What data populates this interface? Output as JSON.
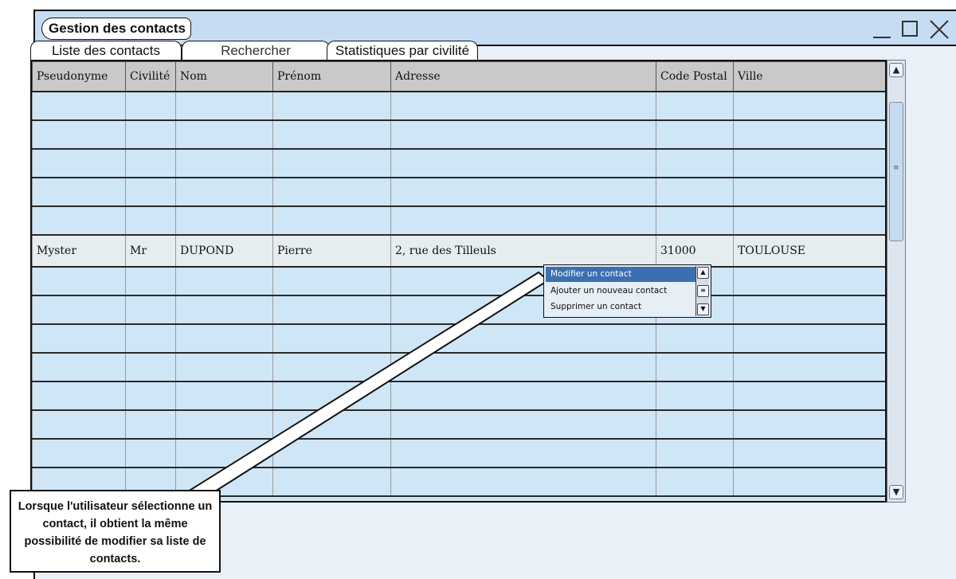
{
  "window": {
    "title": "Gestion des contacts",
    "controls": {
      "minimize": "minimize-icon",
      "maximize": "maximize-icon",
      "close": "close-icon"
    }
  },
  "tabs": [
    {
      "label": "Liste des contacts"
    },
    {
      "label": "Rechercher"
    },
    {
      "label": "Statistiques par civilité"
    }
  ],
  "table": {
    "columns": [
      "Pseudonyme",
      "Civilité",
      "Nom",
      "Prénom",
      "Adresse",
      "Code Postal",
      "Ville"
    ],
    "selected_row": {
      "pseudonyme": "Myster",
      "civilite": "Mr",
      "nom": "DUPOND",
      "prenom": "Pierre",
      "adresse": "2, rue des Tilleuls",
      "code_postal": "31000",
      "ville": "TOULOUSE"
    }
  },
  "context_menu": {
    "items": [
      "Modifier un contact",
      "Ajouter un nouveau contact",
      "Supprimer un contact"
    ],
    "active_index": 0
  },
  "callout": {
    "text": "Lorsque l'utilisateur sélectionne un contact, il obtient la même possibilité de modifier sa liste de contacts."
  },
  "colors": {
    "titlebar": "#c6dcf3",
    "row": "#cfe6f6",
    "header": "#c9c9c9",
    "menu_highlight": "#3b6fb0"
  }
}
